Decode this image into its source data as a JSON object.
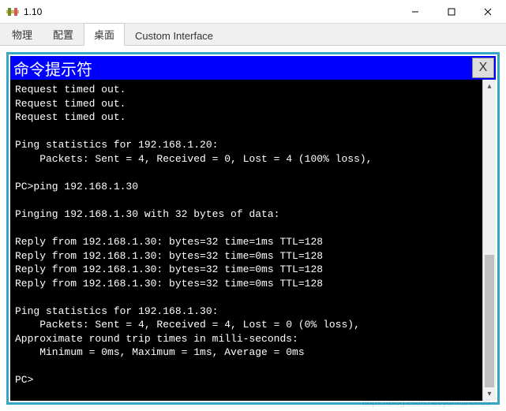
{
  "window": {
    "title": "1.10"
  },
  "tabs": {
    "t0": "物理",
    "t1": "配置",
    "t2": "桌面",
    "t3": "Custom Interface"
  },
  "terminal": {
    "title": "命令提示符",
    "close": "X",
    "output": "Request timed out.\nRequest timed out.\nRequest timed out.\n\nPing statistics for 192.168.1.20:\n    Packets: Sent = 4, Received = 0, Lost = 4 (100% loss),\n\nPC>ping 192.168.1.30\n\nPinging 192.168.1.30 with 32 bytes of data:\n\nReply from 192.168.1.30: bytes=32 time=1ms TTL=128\nReply from 192.168.1.30: bytes=32 time=0ms TTL=128\nReply from 192.168.1.30: bytes=32 time=0ms TTL=128\nReply from 192.168.1.30: bytes=32 time=0ms TTL=128\n\nPing statistics for 192.168.1.30:\n    Packets: Sent = 4, Received = 4, Lost = 0 (0% loss),\nApproximate round trip times in milli-seconds:\n    Minimum = 0ms, Maximum = 1ms, Average = 0ms\n\nPC>"
  },
  "scrollbar": {
    "up": "▴",
    "down": "▾"
  },
  "watermark": "https://blog.csdn.net/yunhan0609"
}
